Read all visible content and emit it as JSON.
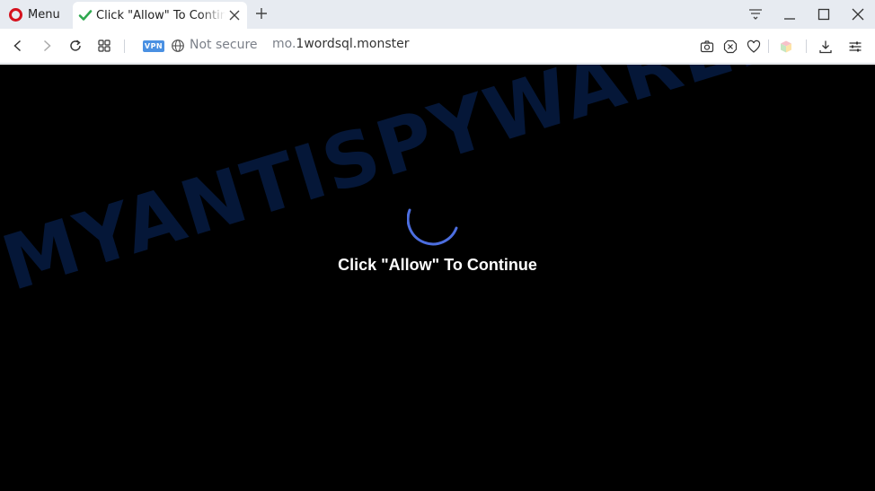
{
  "browser": {
    "menu_label": "Menu",
    "tab": {
      "title": "Click \"Allow\" To Continue"
    },
    "address": {
      "vpn_label": "VPN",
      "security_label": "Not secure",
      "url_prefix": "mo.",
      "url_domain": "1wordsql.monster"
    }
  },
  "page": {
    "message": "Click \"Allow\" To Continue",
    "watermark": "MYANTISPYWARE.COM",
    "background_color": "#000000",
    "spinner_color": "#4c6ee0"
  },
  "icons": {
    "tab": "check-icon",
    "address_left": [
      "back-icon",
      "forward-icon",
      "reload-icon",
      "speed-dial-icon"
    ],
    "address_right": [
      "snapshot-icon",
      "adblock-icon",
      "heart-icon",
      "extension-cube-icon",
      "download-icon",
      "easy-setup-icon"
    ],
    "window": [
      "tab-menu-icon",
      "minimize-icon",
      "maximize-icon",
      "close-window-icon"
    ]
  }
}
